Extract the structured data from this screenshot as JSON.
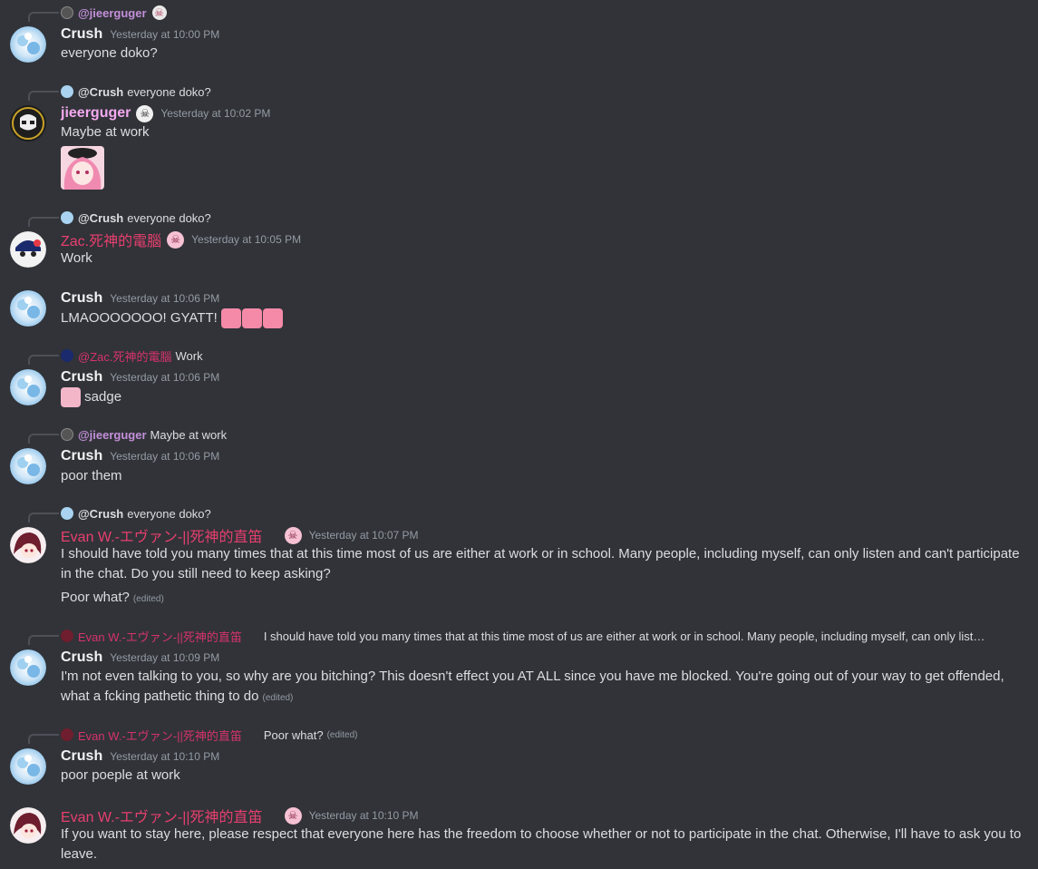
{
  "users": {
    "crush": "Crush",
    "jiee": "jieerguger",
    "zac": "Zac.死神的電腦",
    "evan": "Evan W.-エヴァン-||死神的直笛"
  },
  "messages": [
    {
      "reply_name": "@jieerguger",
      "author": "Crush",
      "time": "Yesterday at 10:00 PM",
      "text": "everyone doko?"
    },
    {
      "reply_name": "@Crush",
      "reply_text": "everyone doko?",
      "author": "jieerguger",
      "time": "Yesterday at 10:02 PM",
      "text": "Maybe at work"
    },
    {
      "reply_name": "@Crush",
      "reply_text": "everyone doko?",
      "author": "Zac.死神的電腦",
      "time": "Yesterday at 10:05 PM",
      "text": "Work"
    },
    {
      "author": "Crush",
      "time": "Yesterday at 10:06 PM",
      "text": "LMAOOOOOOO! GYATT!"
    },
    {
      "reply_name": "@Zac.死神的電腦",
      "reply_text": "Work",
      "author": "Crush",
      "time": "Yesterday at 10:06 PM",
      "text": "sadge"
    },
    {
      "reply_name": "@jieerguger",
      "reply_text": "Maybe at work",
      "author": "Crush",
      "time": "Yesterday at 10:06 PM",
      "text": "poor them"
    },
    {
      "reply_name": "@Crush",
      "reply_text": "everyone doko?",
      "author": "Evan W.-エヴァン-||死神的直笛",
      "time": "Yesterday at 10:07 PM",
      "text": "I should have told you many times that at this time most of us are either at work or in school. Many people, including myself, can only listen and can't participate in the chat. Do you still need to keep asking?",
      "text2": "Poor what?",
      "edited": "(edited)"
    },
    {
      "reply_name": "Evan W.-エヴァン-||死神的直笛",
      "reply_text": "I should have told you many times that at this time most of us are either at work or in school. Many people, including myself, can only list…",
      "author": "Crush",
      "time": "Yesterday at 10:09 PM",
      "text": "I'm not even talking to you, so why are you bitching? This doesn't effect you AT ALL since you have me blocked. You're going out of your way to get offended, what a fcking pathetic thing to do",
      "edited": "(edited)"
    },
    {
      "reply_name": "Evan W.-エヴァン-||死神的直笛",
      "reply_text": "Poor what?",
      "reply_edited": "(edited)",
      "author": "Crush",
      "time": "Yesterday at 10:10 PM",
      "text": "poor poeple at work"
    },
    {
      "author": "Evan W.-エヴァン-||死神的直笛",
      "time": "Yesterday at 10:10 PM",
      "text": "If you want to stay here, please respect that everyone here has the freedom to choose whether or not to participate in the chat. Otherwise, I'll have to ask you to leave."
    }
  ]
}
